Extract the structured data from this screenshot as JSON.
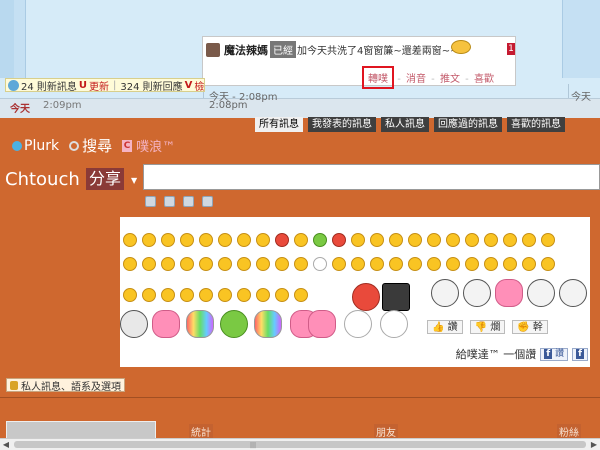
{
  "timeline": {
    "counters": {
      "new_plurks": "24 則新訊息",
      "u_label": "U",
      "update_link": "更新",
      "new_replies": "324 則新回應",
      "v_label": "V",
      "check_link": "檢"
    },
    "dates": {
      "left_day": "今天",
      "left_time": "2:09pm",
      "mid_day_time": "今天 - 2:08pm",
      "mid_time": "2:08pm",
      "right_day": "今天"
    }
  },
  "popup": {
    "user": "魔法辣媽",
    "qualifier": "已經",
    "text": "加今天共洗了4窗窗簾~還差兩窗~~~",
    "badge": "1",
    "actions": {
      "replurk": "轉噗",
      "mute": "消音",
      "recommend": "推文",
      "like": "喜歡"
    }
  },
  "filters": [
    "所有訊息",
    "我發表的訊息",
    "私人訊息",
    "回應過的訊息",
    "喜歡的訊息"
  ],
  "nav": {
    "plurk": "Plurk",
    "search": "搜尋",
    "karma": "噗浪™"
  },
  "compose": {
    "username": "Chtouch",
    "qualifier": "分享",
    "placeholder": ""
  },
  "emoticons": {
    "like_buttons": [
      "讚",
      "爛",
      "幹"
    ],
    "footer_text": "給噗達™ 一個讚",
    "share_labels": [
      "讚",
      ""
    ]
  },
  "private_options": "私人訊息、語系及選項",
  "profile_stats": [
    "統計",
    "朋友",
    "粉絲"
  ]
}
